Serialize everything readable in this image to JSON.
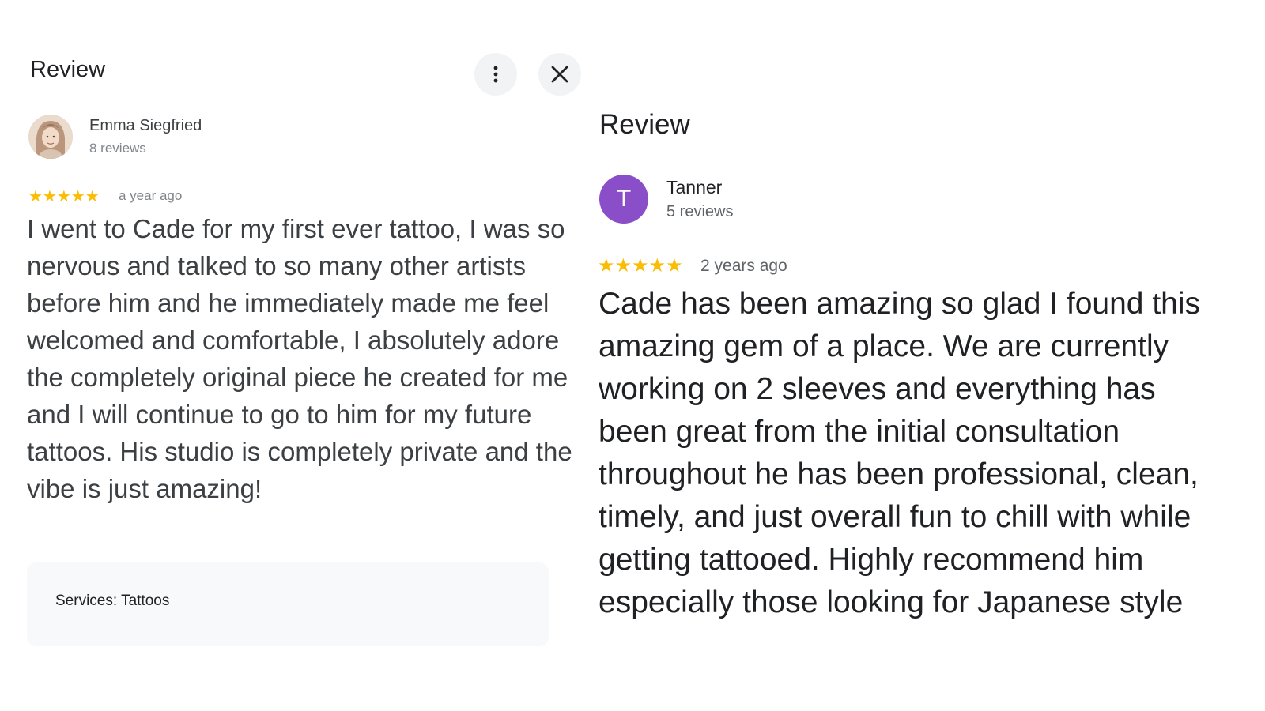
{
  "left_review": {
    "title": "Review",
    "reviewer_name": "Emma Siegfried",
    "review_count": "8 reviews",
    "rating": 5,
    "stars": "★★★★★",
    "date": "a year ago",
    "text": "I went to Cade for my first ever tattoo, I was so nervous and talked to so many other artists before him and he immediately made me feel welcomed and comfortable, I absolutely adore the completely original piece he created for me and I will continue to go to him for my future tattoos. His studio is completely private and the vibe is just amazing!",
    "services": "Services: Tattoos",
    "icons": {
      "more": "more-vert-icon",
      "close": "close-icon"
    }
  },
  "right_review": {
    "title": "Review",
    "avatar_letter": "T",
    "avatar_color": "#8a4fc8",
    "reviewer_name": "Tanner",
    "review_count": "5 reviews",
    "rating": 5,
    "stars": "★★★★★",
    "date": "2 years ago",
    "text": "Cade has been amazing so glad I found this amazing gem of a place. We are currently working on 2 sleeves and everything has been great from the initial consultation throughout he has been professional, clean, timely, and just overall fun to chill with while getting tattooed. Highly recommend him especially those looking for Japanese style"
  },
  "colors": {
    "star": "#fbbc04",
    "button_bg": "#f1f3f4",
    "services_bg": "#f8f9fa"
  }
}
